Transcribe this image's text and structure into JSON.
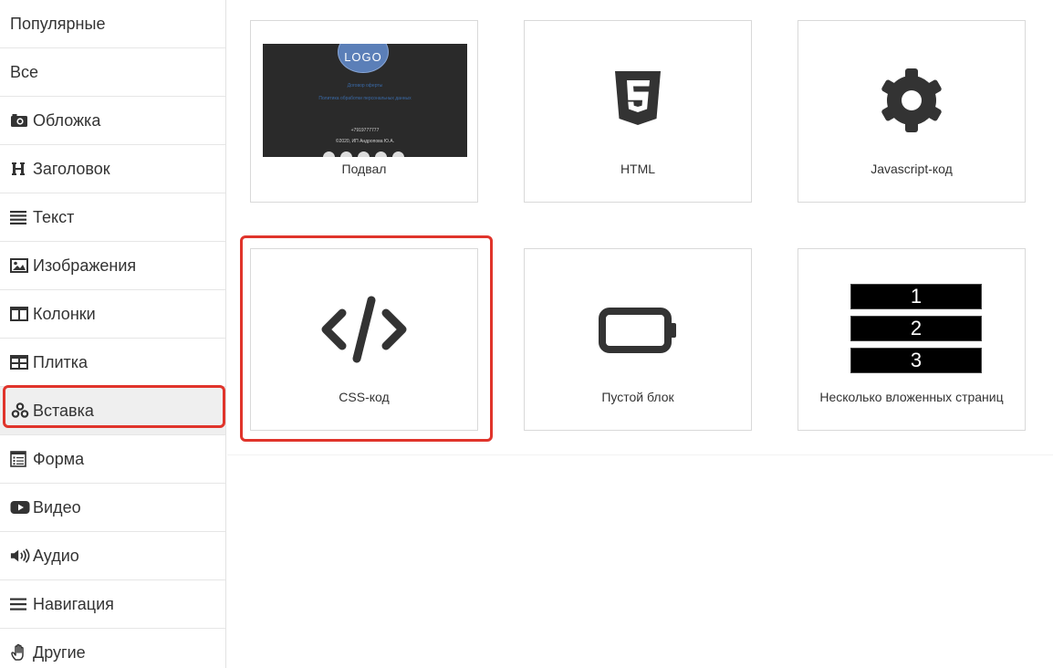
{
  "sidebar": {
    "items": [
      {
        "label": "Популярные",
        "icon": "none"
      },
      {
        "label": "Все",
        "icon": "none"
      },
      {
        "label": "Обложка",
        "icon": "camera-icon"
      },
      {
        "label": "Заголовок",
        "icon": "heading-icon"
      },
      {
        "label": "Текст",
        "icon": "align-justify-icon"
      },
      {
        "label": "Изображения",
        "icon": "image-icon"
      },
      {
        "label": "Колонки",
        "icon": "columns-icon"
      },
      {
        "label": "Плитка",
        "icon": "grid-icon"
      },
      {
        "label": "Вставка",
        "icon": "cubes-icon",
        "active": true
      },
      {
        "label": "Форма",
        "icon": "form-icon"
      },
      {
        "label": "Видео",
        "icon": "youtube-icon"
      },
      {
        "label": "Аудио",
        "icon": "volume-icon"
      },
      {
        "label": "Навигация",
        "icon": "bars-icon"
      },
      {
        "label": "Другие",
        "icon": "hand-icon"
      }
    ]
  },
  "cards": [
    {
      "label": "Подвал",
      "thumb": {
        "logo": "LOGO",
        "line1": "Договор оферты",
        "line2": "Политика обработки персональных данных",
        "phone": "+7919777777",
        "copyright": "©2020, ИП Андропова Ю.А."
      }
    },
    {
      "label": "HTML",
      "icon": "html5-icon"
    },
    {
      "label": "Javascript-код",
      "icon": "gear-icon"
    },
    {
      "label": "CSS-код",
      "icon": "code-icon",
      "selected": true
    },
    {
      "label": "Пустой блок",
      "icon": "empty-battery-icon"
    },
    {
      "label": "Несколько вложенных страниц",
      "pages": [
        "1",
        "2",
        "3"
      ]
    }
  ],
  "colors": {
    "highlight": "#e0342b",
    "icon": "#333333",
    "active_bg": "#efefef"
  }
}
